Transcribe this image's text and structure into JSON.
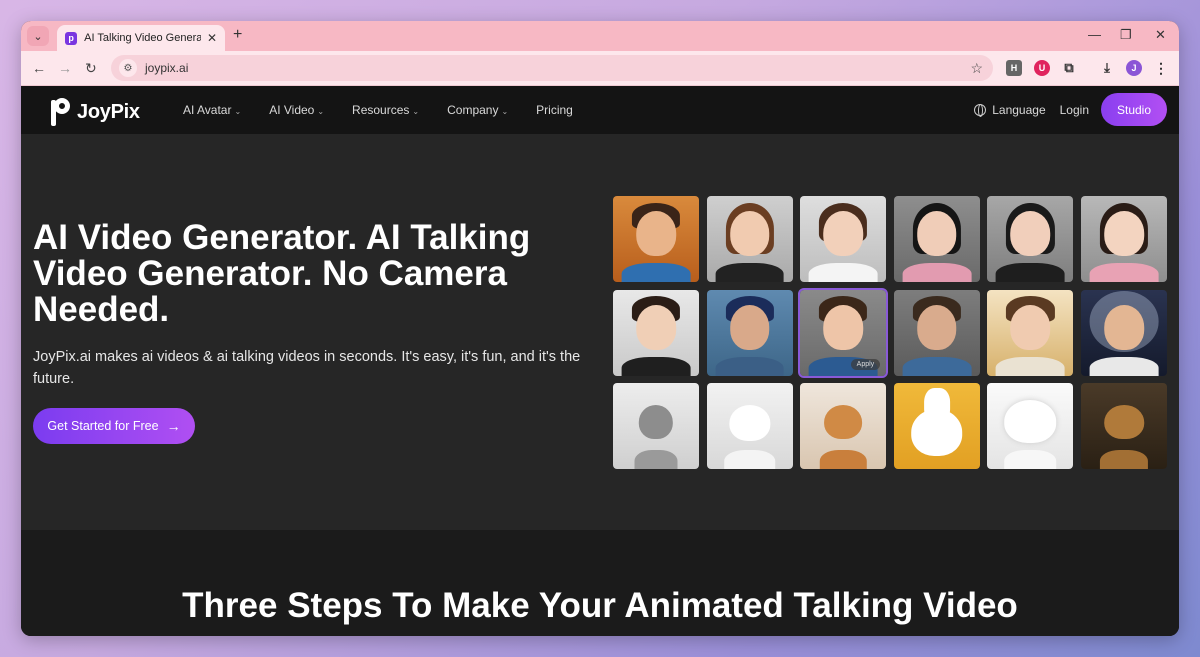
{
  "browser": {
    "tab_title": "AI Talking Video Generator &&",
    "url": "joypix.ai",
    "profile_initial": "J"
  },
  "nav": {
    "logo": "JoyPix",
    "menu": [
      "AI Avatar",
      "AI Video",
      "Resources",
      "Company",
      "Pricing"
    ],
    "language": "Language",
    "login": "Login",
    "studio": "Studio"
  },
  "hero": {
    "title": "AI Video Generator. AI Talking Video Generator. No Camera Needed.",
    "description": "JoyPix.ai makes ai videos & ai talking videos in seconds. It's easy, it's fun, and it's the future.",
    "cta": "Get Started for Free",
    "apply_label": "Apply"
  },
  "steps": {
    "heading": "Three Steps To Make Your Animated Talking Video"
  },
  "colors": {
    "accent": "#8a3ff0",
    "page_bg": "#262626",
    "nav_bg": "#141414"
  }
}
